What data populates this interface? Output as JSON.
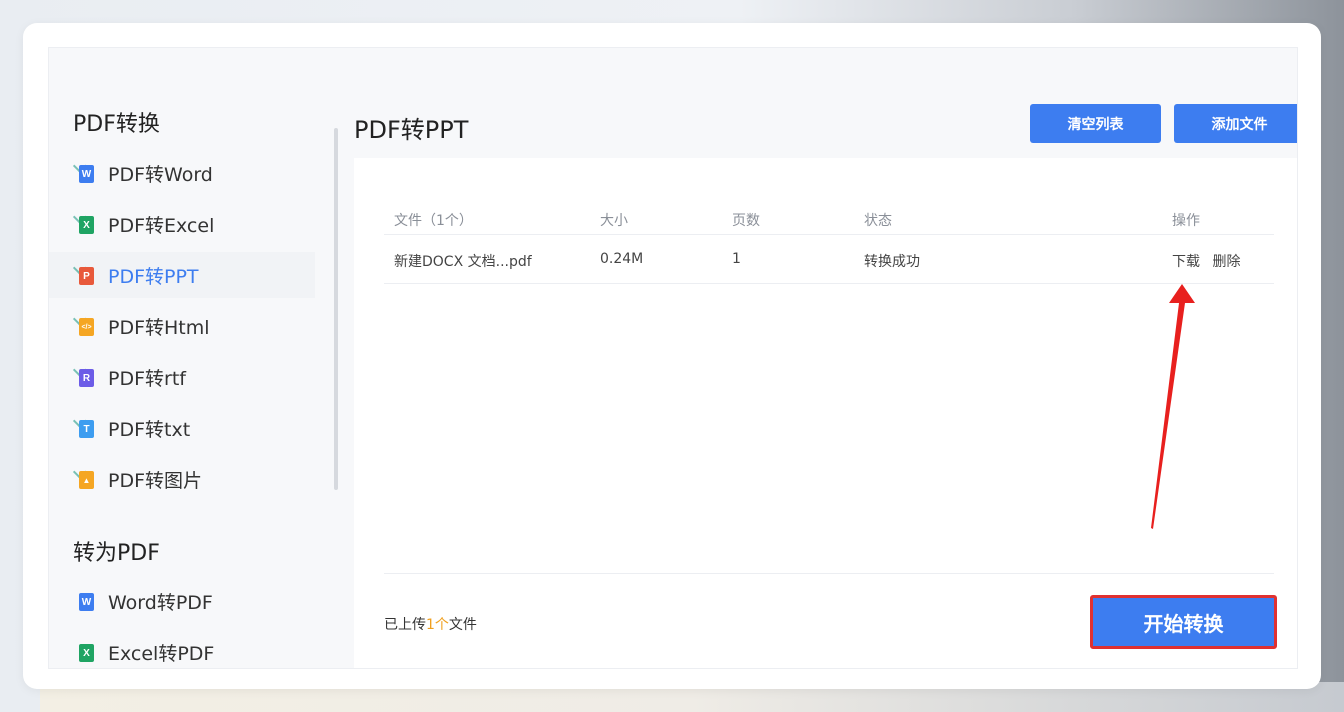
{
  "sidebar": {
    "group1_title": "PDF转换",
    "items": [
      {
        "label": "PDF转Word",
        "badge": "W",
        "color": "#3d7df0"
      },
      {
        "label": "PDF转Excel",
        "badge": "X",
        "color": "#1fa463"
      },
      {
        "label": "PDF转PPT",
        "badge": "P",
        "color": "#e8593b"
      },
      {
        "label": "PDF转Html",
        "badge": "</>",
        "color": "#f5a623"
      },
      {
        "label": "PDF转rtf",
        "badge": "R",
        "color": "#6c5ce7"
      },
      {
        "label": "PDF转txt",
        "badge": "T",
        "color": "#3d9df0"
      },
      {
        "label": "PDF转图片",
        "badge": "▲",
        "color": "#f5a623"
      }
    ],
    "group2_title": "转为PDF",
    "items2": [
      {
        "label": "Word转PDF",
        "badge": "W",
        "color": "#3d7df0"
      },
      {
        "label": "Excel转PDF",
        "badge": "X",
        "color": "#1fa463"
      }
    ]
  },
  "main": {
    "title": "PDF转PPT",
    "clear_label": "清空列表",
    "add_label": "添加文件",
    "columns": {
      "file": "文件（1个）",
      "size": "大小",
      "pages": "页数",
      "status": "状态",
      "action": "操作"
    },
    "rows": [
      {
        "name": "新建DOCX 文档...pdf",
        "size": "0.24M",
        "pages": "1",
        "status": "转换成功",
        "download": "下载",
        "delete": "删除"
      }
    ],
    "footer_prefix": "已上传",
    "footer_count": "1个",
    "footer_suffix": "文件",
    "start_label": "开始转换"
  },
  "colors": {
    "accent": "#3d7df0",
    "highlight": "#e03131"
  }
}
